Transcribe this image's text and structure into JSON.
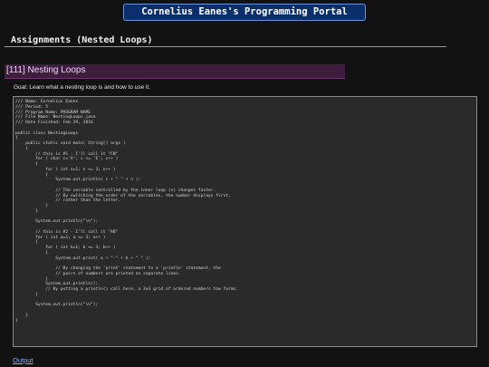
{
  "header": {
    "title": "Cornelius Eanes's Programming Portal"
  },
  "section": {
    "heading": "Assignments (Nested Loops)"
  },
  "lesson": {
    "title": "[111] Nesting Loops",
    "goal": "Goal: Learn what a nesting loop is and how to use it."
  },
  "code": {
    "lines": [
      "/// Name: Cornelius Eanes",
      "/// Period: 5",
      "/// Program Name: PROGRAM NAME",
      "/// File Name: NestingLoops.java",
      "/// Date Finished: Feb 29, 2016",
      "",
      "public class NestingLoops",
      "{",
      "    public static void main( String[] args )",
      "    {",
      "        // this is #1 - I'll call it \"CN\"",
      "        for ( char c='A'; c <= 'E'; c++ )",
      "        {",
      "            for ( int n=1; n <= 3; n++ )",
      "            {",
      "                System.out.println( c + \" \" + n );",
      "",
      "                // The variable controlled by the inner loop (n) changes faster.",
      "                // By switching the order of the variables, the number displays first,",
      "                // rather than the letter.",
      "            }",
      "        }",
      "",
      "        System.out.println(\"\\n\");",
      "",
      "        // this is #2 - I'll call it \"AB\"",
      "        for ( int a=1; a <= 3; a++ )",
      "        {",
      "            for ( int b=1; b <= 3; b++ )",
      "            {",
      "                System.out.print( a + \"-\" + b + \" \" );",
      "",
      "                // By changing the 'print' statement to a 'println' statement, the",
      "                // pairs of numbers are printed on separate lines.",
      "            }",
      "            System.out.println();",
      "            // By putting a println() call here, a 3x3 grid of ordered numbers tow forms.",
      "        }",
      "",
      "        System.out.println(\"\\n\");",
      "",
      "    }",
      "}"
    ]
  },
  "footer": {
    "link_label": "Output"
  }
}
